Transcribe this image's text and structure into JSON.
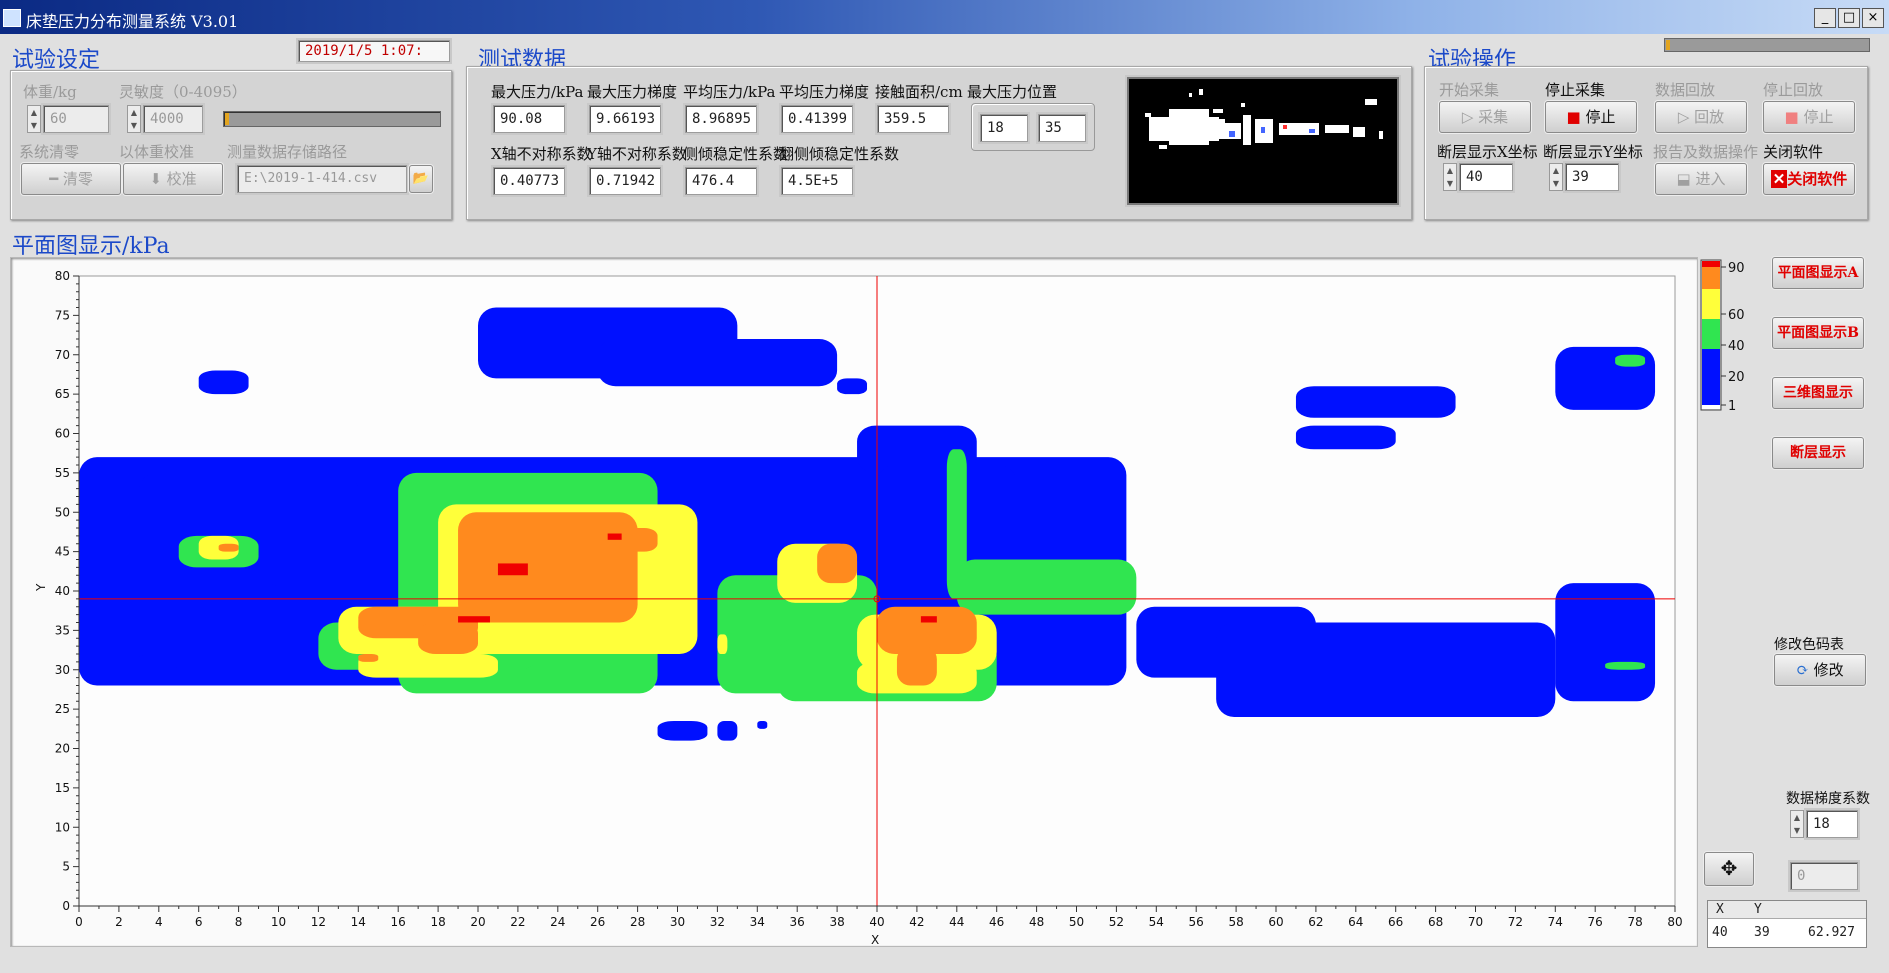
{
  "window": {
    "title": "床垫压力分布测量系统 V3.01",
    "min": "_",
    "max": "□",
    "close": "×"
  },
  "setup": {
    "heading": "试验设定",
    "datetime": "2019/1/5  1:07:",
    "weight_label": "体重/kg",
    "weight_value": "60",
    "sensitivity_label": "灵敏度（0-4095）",
    "sensitivity_value": "4000",
    "zero_label": "系统清零",
    "zero_button": "清零",
    "calibrate_label": "以体重校准",
    "calibrate_button": "校准",
    "path_label": "测量数据存储路径",
    "path_value": "E:\\2019-1-414.csv"
  },
  "test_data": {
    "heading": "测试数据",
    "labels_row1": [
      "最大压力/kPa",
      "最大压力梯度",
      "平均压力/kPa",
      "平均压力梯度",
      "接触面积/cm",
      "最大压力位置"
    ],
    "values_row1": [
      "90.08",
      "9.66193",
      "8.96895",
      "0.41399",
      "359.5"
    ],
    "max_pos": [
      "18",
      "35"
    ],
    "labels_row2": [
      "X轴不对称系数",
      "Y轴不对称系数",
      "侧倾稳定性系数",
      "翻侧倾稳定性系数"
    ],
    "values_row2": [
      "0.40773",
      "0.71942",
      "476.4",
      "4.5E+5"
    ]
  },
  "ops": {
    "heading": "试验操作",
    "start_label": "开始采集",
    "start_button": "采集",
    "stop_label": "停止采集",
    "stop_button": "停止",
    "replay_label": "数据回放",
    "replay_button": "回放",
    "stop_replay_label": "停止回放",
    "stop_replay_button": "停止",
    "x_label": "断层显示X坐标",
    "x_value": "40",
    "y_label": "断层显示Y坐标",
    "y_value": "39",
    "report_label": "报告及数据操作",
    "report_button": "进入",
    "close_label": "关闭软件",
    "close_button": "关闭软件"
  },
  "plot": {
    "heading": "平面图显示/kPa",
    "xlabel": "X",
    "ylabel": "Y",
    "xmax": 80,
    "ymax": 80,
    "cursor": [
      40,
      39
    ]
  },
  "side": {
    "btn_a": "平面图显示A",
    "btn_b": "平面图显示B",
    "btn_3d": "三维图显示",
    "btn_section": "断层显示",
    "colormap_label": "修改色码表",
    "colormap_button": "修改",
    "gradient_label": "数据梯度系数",
    "gradient_value": "18",
    "aux_value": "0"
  },
  "legend": {
    "ticks": [
      "90",
      "60",
      "40",
      "20",
      "1"
    ]
  },
  "readout": {
    "x_header": "X",
    "y_header": "Y",
    "x": "40",
    "y": "39",
    "value": "62.927"
  },
  "colors": {
    "blue": "#0010ff",
    "green": "#30e550",
    "yellow": "#ffff3a",
    "orange": "#ff8a1e",
    "red": "#f00000",
    "accent": "#1b49c9"
  }
}
